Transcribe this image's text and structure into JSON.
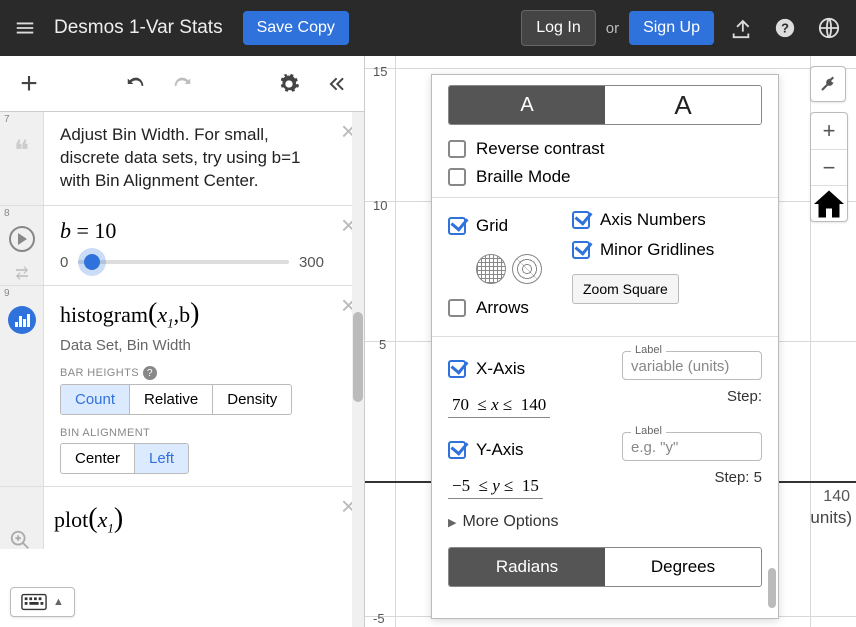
{
  "header": {
    "title": "Desmos 1-Var Stats",
    "save": "Save Copy",
    "login": "Log In",
    "or": "or",
    "signup": "Sign Up"
  },
  "leftTools": {},
  "rows": {
    "r7": {
      "idx": "7",
      "text": "Adjust Bin Width.  For small, discrete data sets, try using b=1 with Bin Alignment Center."
    },
    "r8": {
      "idx": "8",
      "math": "b = 10",
      "min": "0",
      "max": "300"
    },
    "r9": {
      "idx": "9",
      "math_a": "histogram",
      "math_b": "x",
      "math_c": "1",
      "math_d": ",b",
      "sub": "Data Set, Bin Width",
      "bh_label": "BAR HEIGHTS",
      "bh": [
        "Count",
        "Relative",
        "Density"
      ],
      "ba_label": "BIN ALIGNMENT",
      "ba": [
        "Center",
        "Left"
      ]
    },
    "r10": {
      "math_a": "plot",
      "math_b": "x",
      "math_c": "1"
    }
  },
  "graph": {
    "y15": "15",
    "y10": "10",
    "y5": "5",
    "ym5": "-5",
    "x140": "140",
    "units": "units)"
  },
  "settings": {
    "fontA": "A",
    "fontA2": "A",
    "reverse": "Reverse contrast",
    "braille": "Braille Mode",
    "grid": "Grid",
    "arrows": "Arrows",
    "axisnum": "Axis Numbers",
    "minor": "Minor Gridlines",
    "zoomsq": "Zoom Square",
    "xaxis": "X-Axis",
    "xlabel_leg": "Label",
    "xlabel_ph": "variable (units)",
    "xrange_a": "70",
    "xrange_op1": "≤",
    "xrange_var": "x",
    "xrange_op2": "≤",
    "xrange_b": "140",
    "xstep": "Step:",
    "yaxis": "Y-Axis",
    "ylabel_leg": "Label",
    "ylabel_ph": "e.g. \"y\"",
    "yrange_a": "−5",
    "yrange_op1": "≤",
    "yrange_var": "y",
    "yrange_op2": "≤",
    "yrange_b": "15",
    "ystep": "Step: 5",
    "more": "More Options",
    "radians": "Radians",
    "degrees": "Degrees"
  }
}
